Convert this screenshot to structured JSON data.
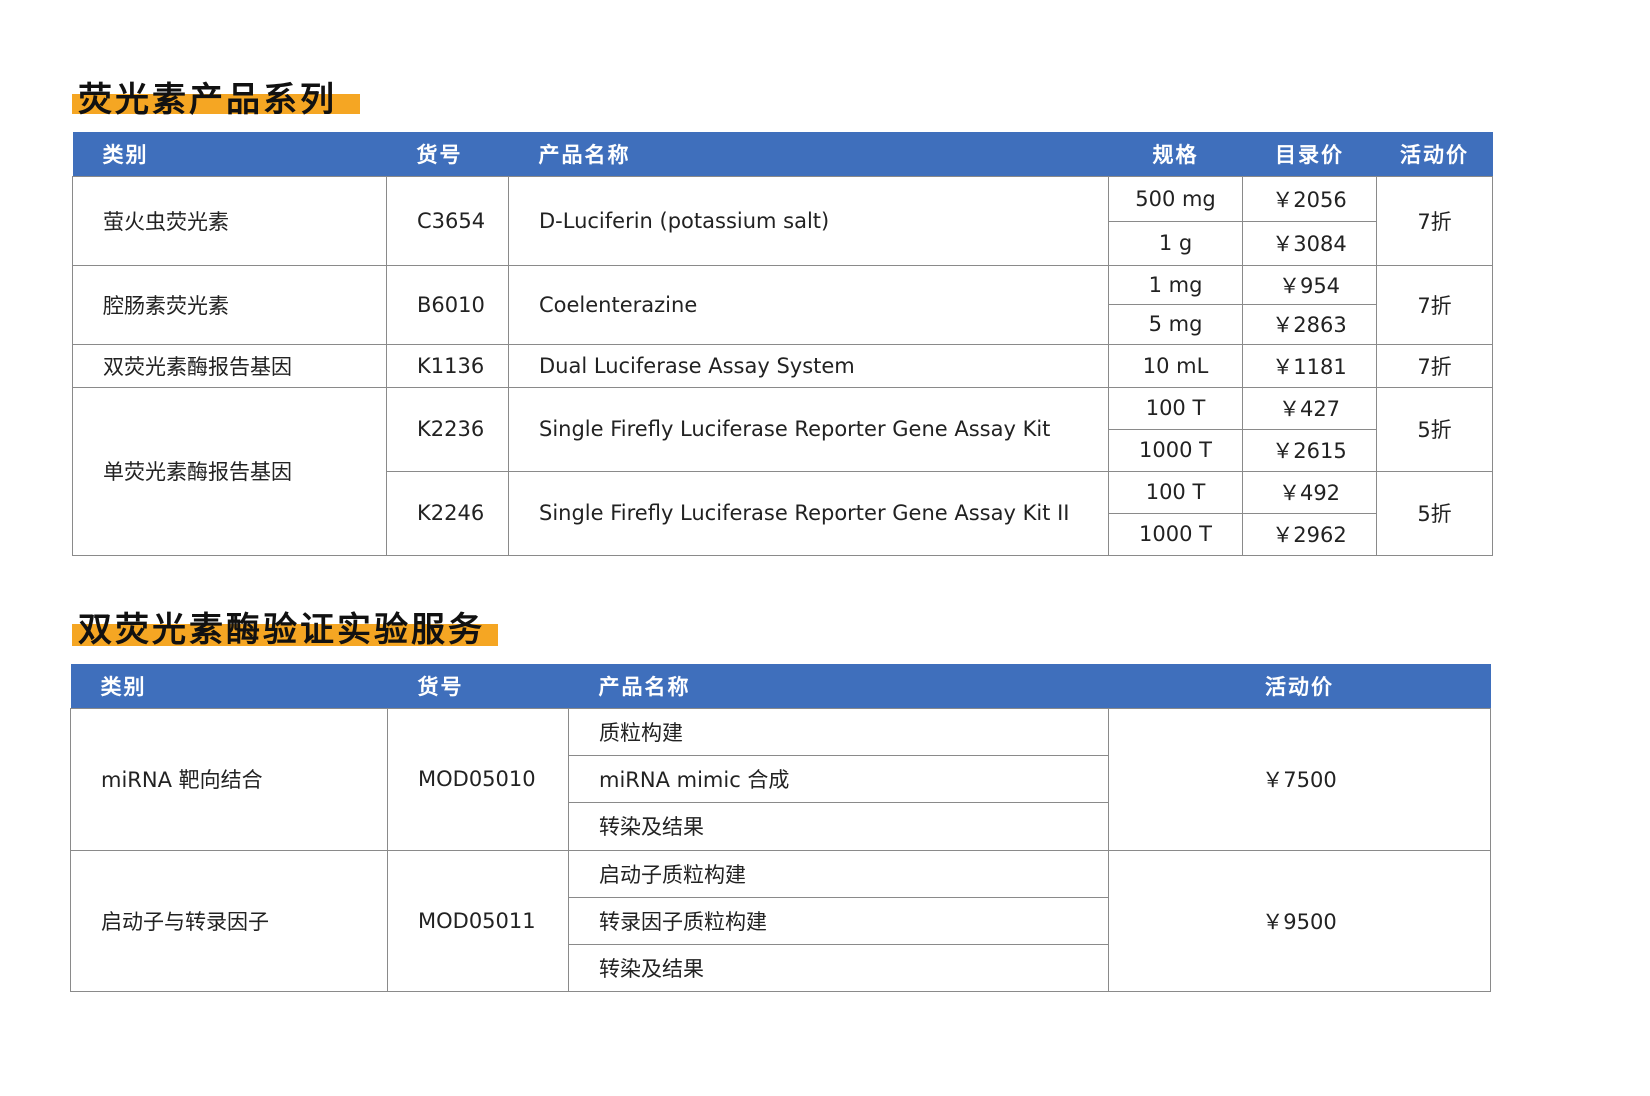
{
  "section1": {
    "title": "荧光素产品系列",
    "headers": [
      "类别",
      "货号",
      "产品名称",
      "规格",
      "目录价",
      "活动价"
    ],
    "rows": [
      {
        "category": "萤火虫荧光素",
        "sku": "C3654",
        "name": "D-Luciferin (potassium salt)",
        "specs": [
          {
            "size": "500 mg",
            "price": "￥2056"
          },
          {
            "size": "1 g",
            "price": "￥3084"
          }
        ],
        "discount": "7折"
      },
      {
        "category": "腔肠素荧光素",
        "sku": "B6010",
        "name": "Coelenterazine",
        "specs": [
          {
            "size": "1 mg",
            "price": "￥954"
          },
          {
            "size": "5 mg",
            "price": "￥2863"
          }
        ],
        "discount": "7折"
      },
      {
        "category": "双荧光素酶报告基因",
        "sku": "K1136",
        "name": "Dual Luciferase Assay System",
        "specs": [
          {
            "size": "10 mL",
            "price": "￥1181"
          }
        ],
        "discount": "7折"
      },
      {
        "category": "单荧光素酶报告基因",
        "sku": "K2236",
        "name": "Single Firefly Luciferase Reporter Gene Assay Kit",
        "specs": [
          {
            "size": "100 T",
            "price": "￥427"
          },
          {
            "size": "1000 T",
            "price": "￥2615"
          }
        ],
        "discount": "5折"
      },
      {
        "category": "",
        "sku": "K2246",
        "name": "Single Firefly Luciferase Reporter Gene Assay Kit II",
        "specs": [
          {
            "size": "100 T",
            "price": "￥492"
          },
          {
            "size": "1000 T",
            "price": "￥2962"
          }
        ],
        "discount": "5折"
      }
    ]
  },
  "section2": {
    "title": "双荧光素酶验证实验服务",
    "headers": [
      "类别",
      "货号",
      "产品名称",
      "活动价"
    ],
    "rows": [
      {
        "category": "miRNA 靶向结合",
        "sku": "MOD05010",
        "items": [
          "质粒构建",
          "miRNA mimic 合成",
          "转染及结果"
        ],
        "price": "￥7500"
      },
      {
        "category": "启动子与转录因子",
        "sku": "MOD05011",
        "items": [
          "启动子质粒构建",
          "转录因子质粒构建",
          "转染及结果"
        ],
        "price": "￥9500"
      }
    ]
  },
  "colors": {
    "header": "#3f6fbc",
    "accent": "#f5a623",
    "border": "#8a8a8a"
  }
}
